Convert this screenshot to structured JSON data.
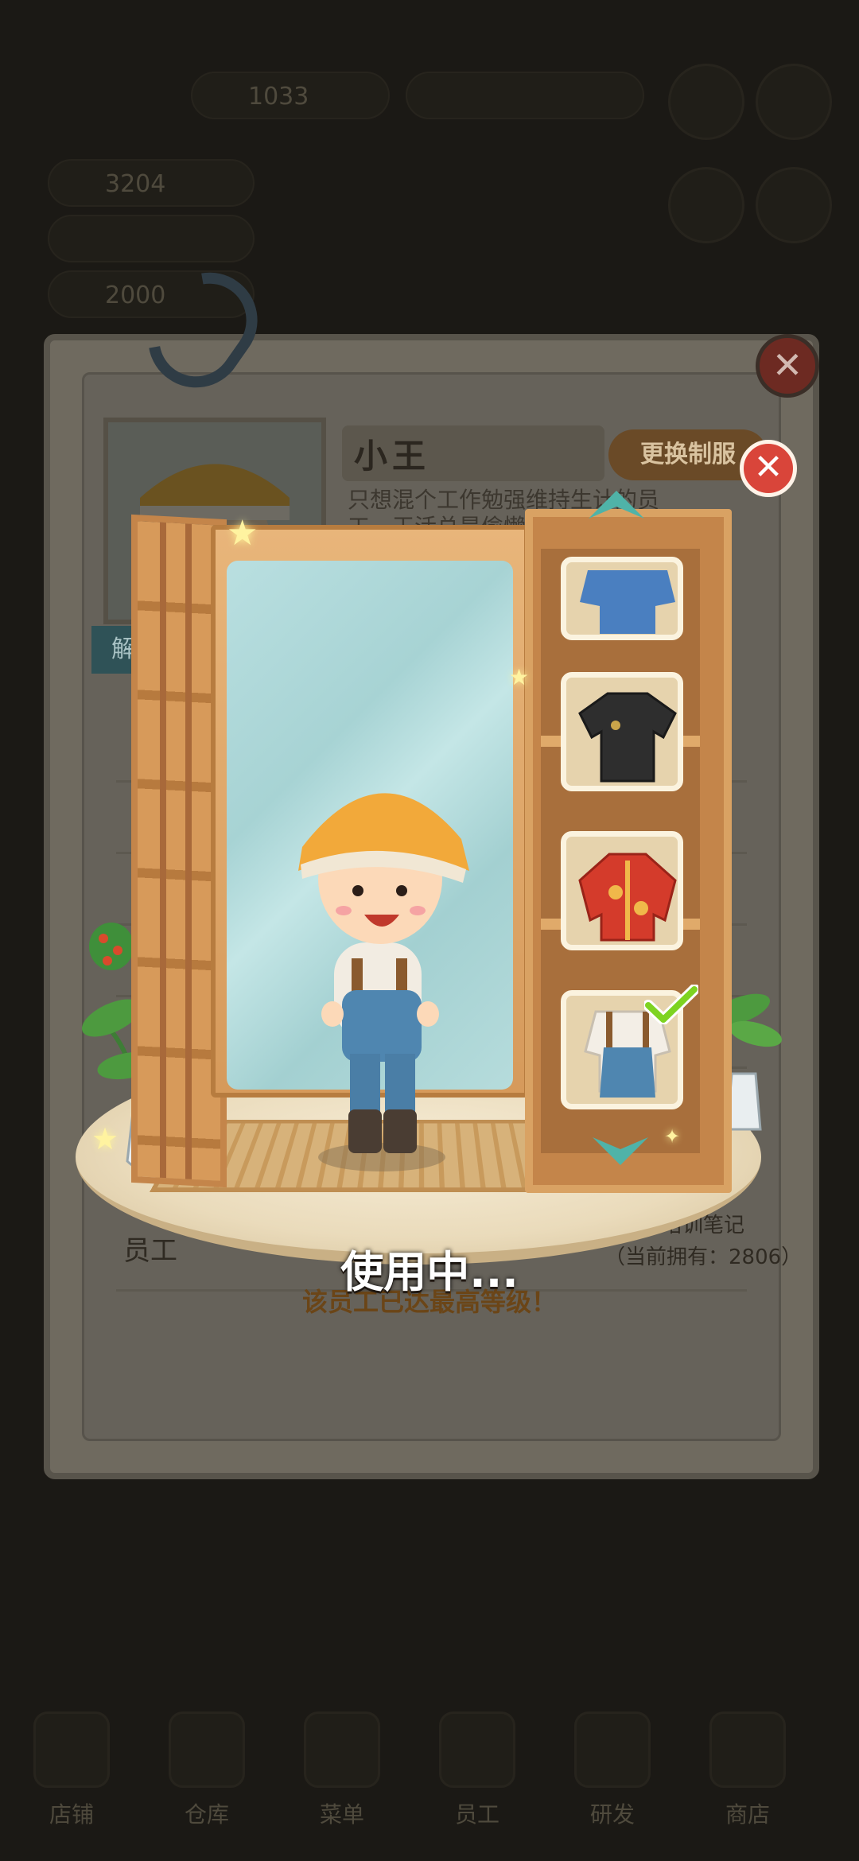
{
  "background_hud": {
    "resource_1": "1033",
    "resource_2": "3204",
    "resource_3": "2000",
    "nav": [
      "店铺",
      "仓库",
      "菜单",
      "员工",
      "研发",
      "商店"
    ]
  },
  "employee_card": {
    "name": "小王",
    "description": "只想混个工作勉强维持生计的员工，干活总是偷懒摸鱼",
    "change_uniform_label": "更换制服",
    "unlock_tag": "解",
    "row_label": "员工",
    "study_note": "需要培训笔记",
    "owned_count": "（当前拥有：2806）",
    "max_level_text": "该员工已达最高等级！"
  },
  "wardrobe": {
    "status_text": "使用中...",
    "outfits": [
      {
        "name": "blue-shirt-icon",
        "selected": false
      },
      {
        "name": "black-shirt-icon",
        "selected": false
      },
      {
        "name": "red-tang-jacket-icon",
        "selected": false
      },
      {
        "name": "overalls-icon",
        "selected": true
      }
    ]
  },
  "colors": {
    "accent_red": "#d9453a",
    "wood": "#c4854a",
    "mirror": "#a7d3d4",
    "check": "#7ed321"
  }
}
